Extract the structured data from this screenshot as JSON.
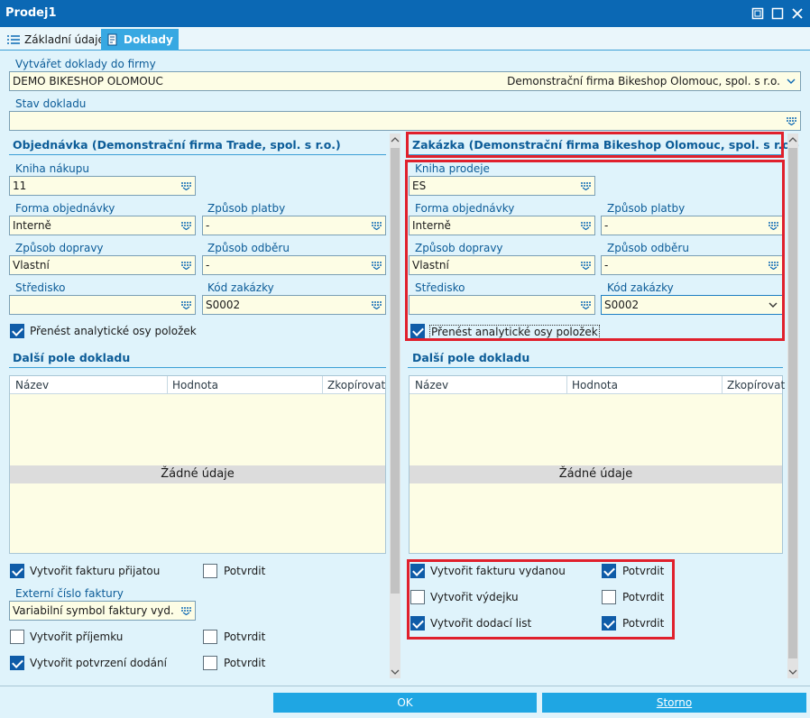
{
  "window": {
    "title": "Prodej1"
  },
  "tabs": [
    {
      "label": "Základní údaje"
    },
    {
      "label": "Doklady"
    }
  ],
  "top": {
    "firm_label": "Vytvářet doklady do firmy",
    "firm_code": "DEMO BIKESHOP OLOMOUC",
    "firm_name": "Demonstrační firma Bikeshop Olomouc, spol. s r.o.",
    "state_label": "Stav dokladu",
    "state_value": ""
  },
  "left": {
    "title": "Objednávka (Demonstrační firma Trade, spol. s r.o.)",
    "book_label": "Kniha nákupu",
    "book_value": "11",
    "form_label": "Forma objednávky",
    "form_value": "Interně",
    "payment_label": "Způsob platby",
    "payment_value": "-",
    "transport_label": "Způsob dopravy",
    "transport_value": "Vlastní",
    "pickup_label": "Způsob odběru",
    "pickup_value": "-",
    "center_label": "Středisko",
    "center_value": "",
    "order_label": "Kód zakázky",
    "order_value": "S0002",
    "transfer_label": "Přenést analytické osy položek",
    "extra_title": "Další pole dokladu",
    "cols": [
      "Název",
      "Hodnota",
      "Zkopírovat"
    ],
    "empty": "Žádné údaje",
    "opt1": "Vytvořit fakturu přijatou",
    "opt1_confirm": "Potvrdit",
    "ext_label": "Externí číslo faktury",
    "ext_value": "Variabilní symbol faktury vyd.",
    "opt2": "Vytvořit příjemku",
    "opt2_confirm": "Potvrdit",
    "opt3": "Vytvořit potvrzení dodání",
    "opt3_confirm": "Potvrdit"
  },
  "right": {
    "title": "Zakázka (Demonstrační firma Bikeshop Olomouc, spol. s r.o.)",
    "book_label": "Kniha prodeje",
    "book_value": "ES",
    "form_label": "Forma objednávky",
    "form_value": "Interně",
    "payment_label": "Způsob platby",
    "payment_value": "-",
    "transport_label": "Způsob dopravy",
    "transport_value": "Vlastní",
    "pickup_label": "Způsob odběru",
    "pickup_value": "-",
    "center_label": "Středisko",
    "center_value": "",
    "order_label": "Kód zakázky",
    "order_value": "S0002",
    "transfer_label": "Přenést analytické osy položek",
    "extra_title": "Další pole dokladu",
    "cols": [
      "Název",
      "Hodnota",
      "Zkopírovat"
    ],
    "empty": "Žádné údaje",
    "opt1": "Vytvořit fakturu vydanou",
    "opt1_confirm": "Potvrdit",
    "opt2": "Vytvořit výdejku",
    "opt2_confirm": "Potvrdit",
    "opt3": "Vytvořit dodací list",
    "opt3_confirm": "Potvrdit"
  },
  "buttons": {
    "ok": "OK",
    "cancel": "Storno"
  },
  "colors": {
    "accent": "#0b68b4",
    "highlight": "#e0202c",
    "field_bg": "#fdfde5"
  }
}
